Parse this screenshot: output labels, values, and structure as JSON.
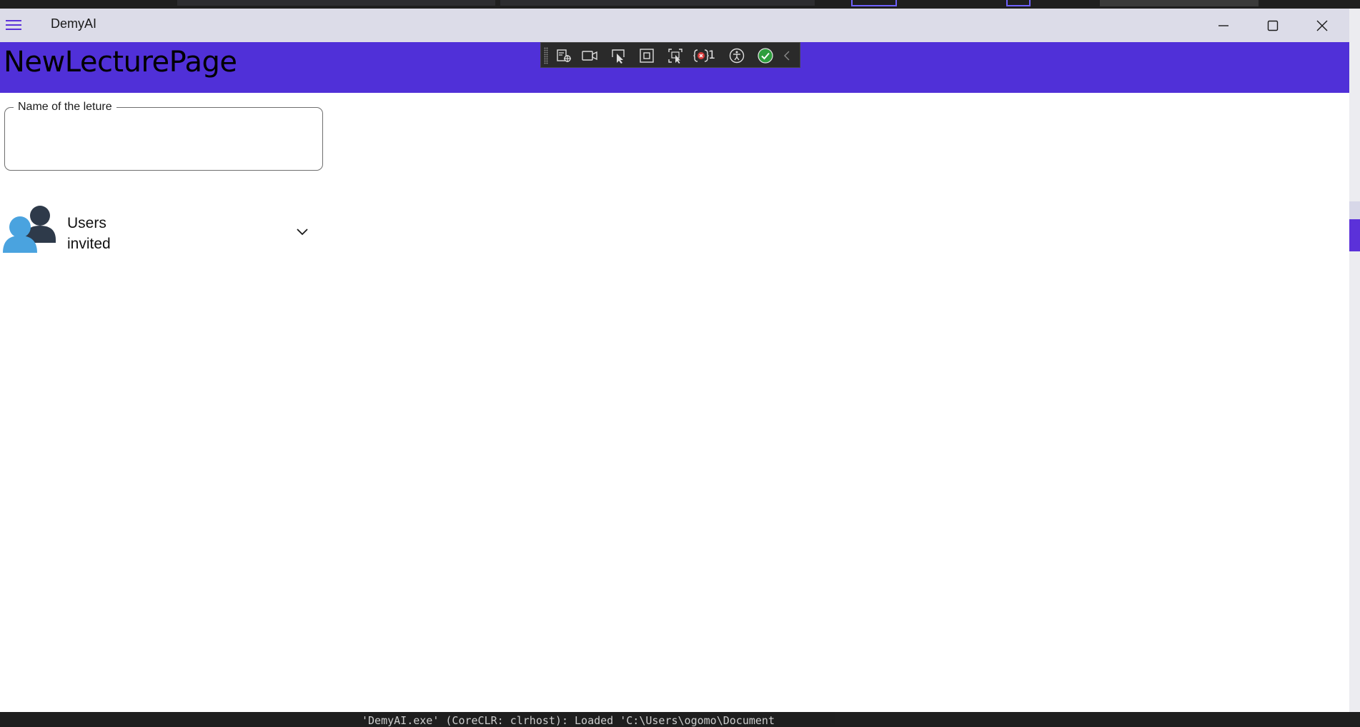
{
  "window": {
    "title": "DemyAI"
  },
  "page": {
    "title": "NewLecturePage"
  },
  "form": {
    "lecture_name": {
      "label": "Name of the leture",
      "value": ""
    }
  },
  "users_section": {
    "line1": "Users",
    "line2": "invited"
  },
  "debug_toolbar": {
    "error_count": "1"
  },
  "ide": {
    "output_line": "'DemyAI.exe' (CoreCLR: clrhost): Loaded 'C:\\Users\\ogomo\\Document"
  },
  "colors": {
    "accent": "#5030d8",
    "titlebar": "#dcdce8",
    "users_icon_front": "#4aa3df",
    "users_icon_back": "#2e3a4a"
  }
}
